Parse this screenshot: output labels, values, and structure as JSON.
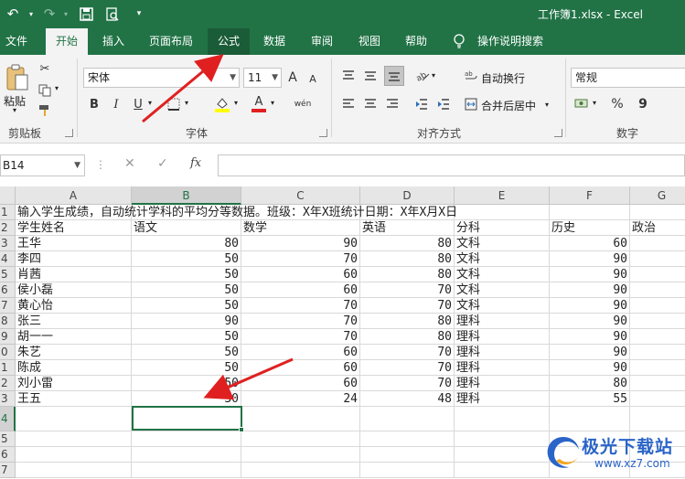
{
  "window": {
    "title": "工作簿1.xlsx  -  Excel"
  },
  "menu": {
    "tabs": [
      "文件",
      "开始",
      "插入",
      "页面布局",
      "公式",
      "数据",
      "审阅",
      "视图",
      "帮助"
    ],
    "active": "开始",
    "highlighted": "公式",
    "tell_me": "操作说明搜索"
  },
  "ribbon": {
    "clipboard": {
      "label": "剪贴板",
      "paste": "粘贴"
    },
    "font": {
      "label": "字体",
      "name": "宋体",
      "size": "11",
      "grow": "A",
      "shrink": "A",
      "bold": "B",
      "italic": "I",
      "underline": "U",
      "phonetic": "wén"
    },
    "alignment": {
      "label": "对齐方式",
      "wrap": "自动换行",
      "merge": "合并后居中"
    },
    "number": {
      "label": "数字",
      "format": "常规",
      "percent": "%",
      "comma": "9"
    }
  },
  "formula_bar": {
    "name_box": "B14",
    "fx": "fx",
    "content": ""
  },
  "sheet": {
    "columns": [
      "A",
      "B",
      "C",
      "D",
      "E",
      "F",
      "G"
    ],
    "selected_column": "B",
    "selected_row": "14",
    "row_labels": [
      "1",
      "2",
      "3",
      "4",
      "5",
      "6",
      "7",
      "8",
      "9",
      "0",
      "1",
      "2",
      "3",
      "4",
      "5",
      "6",
      "7"
    ],
    "title_text": "输入学生成绩，自动统计学科的平均分等数据。班级：X年X班统计日期：X年X月X日",
    "headers": [
      "学生姓名",
      "语文",
      "数学",
      "英语",
      "分科",
      "历史",
      "政治"
    ],
    "rows": [
      [
        "王华",
        "80",
        "90",
        "80",
        "文科",
        "60"
      ],
      [
        "李四",
        "50",
        "70",
        "80",
        "文科",
        "90"
      ],
      [
        "肖茜",
        "50",
        "60",
        "80",
        "文科",
        "90"
      ],
      [
        "侯小磊",
        "50",
        "60",
        "70",
        "文科",
        "90"
      ],
      [
        "黄心怡",
        "50",
        "70",
        "70",
        "文科",
        "90"
      ],
      [
        "张三",
        "90",
        "70",
        "80",
        "理科",
        "90"
      ],
      [
        "胡一一",
        "50",
        "70",
        "80",
        "理科",
        "90"
      ],
      [
        "朱艺",
        "50",
        "60",
        "70",
        "理科",
        "90"
      ],
      [
        "陈成",
        "50",
        "60",
        "70",
        "理科",
        "90"
      ],
      [
        "刘小雷",
        "50",
        "60",
        "70",
        "理科",
        "80"
      ],
      [
        "王五",
        "30",
        "24",
        "48",
        "理科",
        "55"
      ]
    ]
  },
  "watermark": {
    "name": "极光下载站",
    "url": "www.xz7.com"
  },
  "colors": {
    "brand": "#217346",
    "annotation_arrow": "#e02020"
  }
}
